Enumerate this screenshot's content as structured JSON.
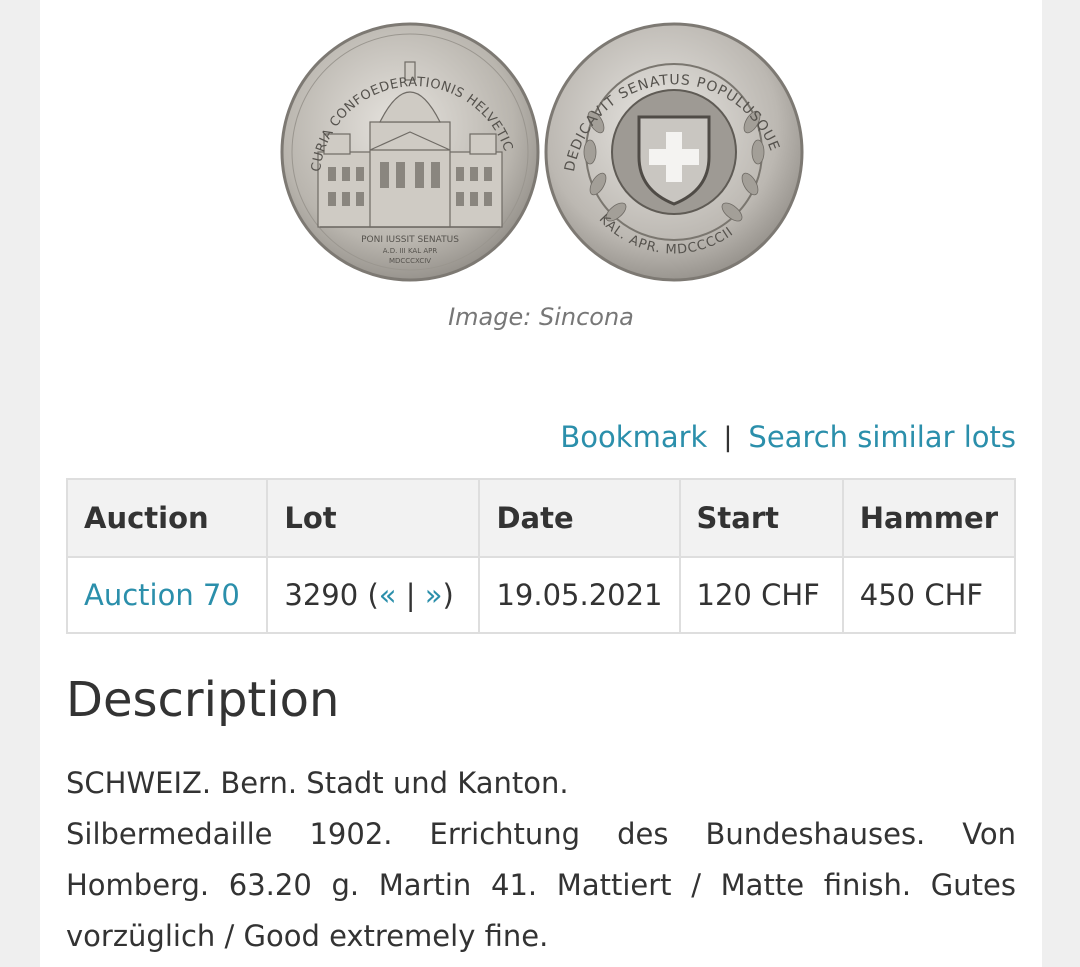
{
  "image": {
    "caption": "Image: Sincona",
    "obverse_inscription": "CURIA CONFOEDERATIONIS HELVETICAE",
    "obverse_exergue": [
      "PONI IUSSIT SENATUS",
      "A.D. III KAL APR",
      "MDCCCXCIV"
    ],
    "reverse_inscription": "DEDICAVIT SENATUS POPULUSQUE",
    "reverse_date": "KAL. APR. MDCCCCII"
  },
  "actions": {
    "bookmark": "Bookmark",
    "separator": "|",
    "search_similar": "Search similar lots"
  },
  "table": {
    "headers": [
      "Auction",
      "Lot",
      "Date",
      "Start",
      "Hammer"
    ],
    "row": {
      "auction": "Auction 70",
      "lot_number": "3290",
      "lot_prev": "«",
      "lot_sep": "|",
      "lot_next": "»",
      "date": "19.05.2021",
      "start": "120 CHF",
      "hammer": "450 CHF"
    }
  },
  "description": {
    "title": "Description",
    "line1": "SCHWEIZ. Bern. Stadt und Kanton.",
    "line2": "Silbermedaille 1902. Errichtung des Bundeshauses. Von Homberg. 63.20 g. Martin 41. Mattiert / Matte finish. Gutes vorzüglich / Good extremely fine."
  }
}
